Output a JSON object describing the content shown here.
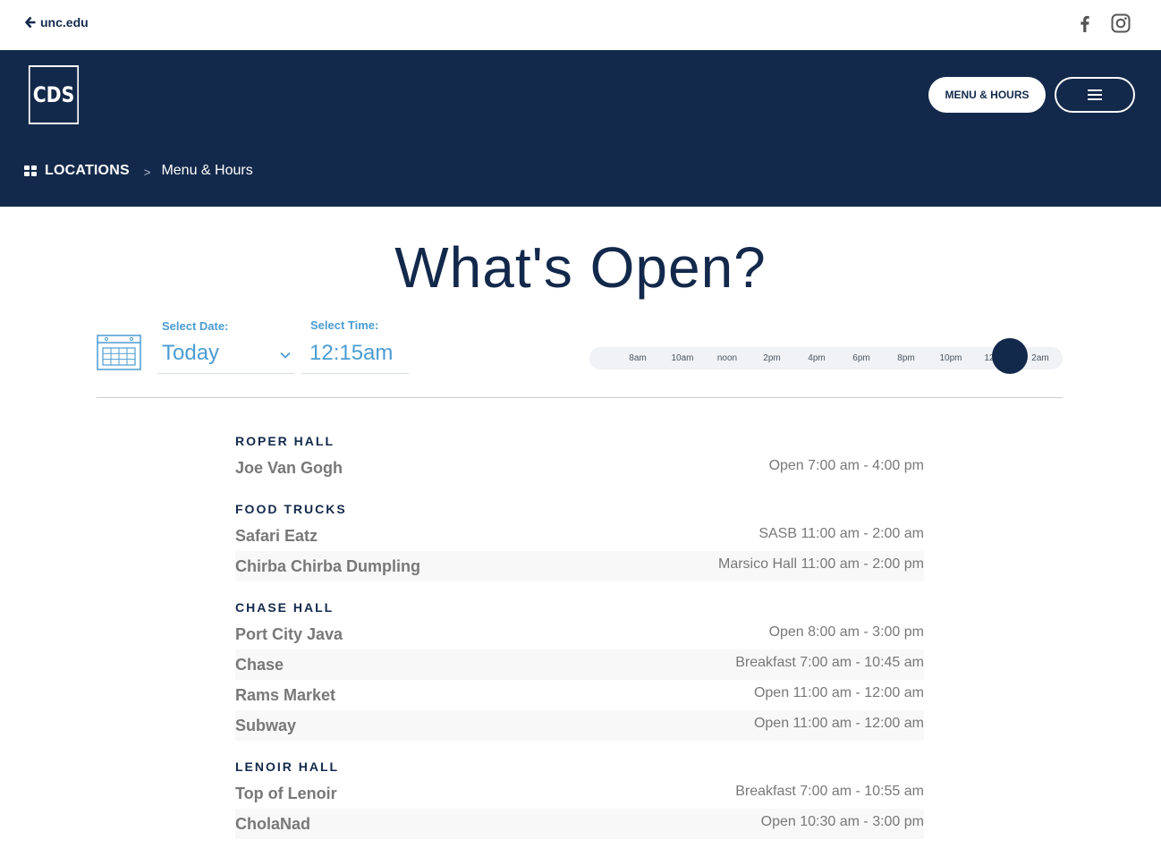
{
  "topbar": {
    "back_label": "unc.edu",
    "social": [
      {
        "icon": "facebook-icon"
      },
      {
        "icon": "instagram-icon"
      }
    ]
  },
  "header": {
    "logo_text": "CDS",
    "menu_hours_label": "MENU & HOURS",
    "breadcrumb": {
      "locations": "LOCATIONS",
      "separator": ">",
      "current": "Menu & Hours"
    }
  },
  "page": {
    "title": "What's Open?"
  },
  "controls": {
    "date_label": "Select Date:",
    "date_value": "Today",
    "time_label": "Select Time:",
    "time_value": "12:15am"
  },
  "slider": {
    "ticks": [
      "8am",
      "10am",
      "noon",
      "2pm",
      "4pm",
      "6pm",
      "8pm",
      "10pm",
      "12am",
      "2am"
    ],
    "current_value": "12:15am"
  },
  "sections": [
    {
      "title": "ROPER HALL",
      "rows": [
        {
          "name": "Joe Van Gogh",
          "hours": "Open 7:00 am - 4:00 pm"
        }
      ]
    },
    {
      "title": "FOOD TRUCKS",
      "rows": [
        {
          "name": "Safari Eatz",
          "hours": "SASB 11:00 am - 2:00 am"
        },
        {
          "name": "Chirba Chirba Dumpling",
          "hours": "Marsico Hall 11:00 am - 2:00 pm"
        }
      ]
    },
    {
      "title": "CHASE HALL",
      "rows": [
        {
          "name": "Port City Java",
          "hours": "Open 8:00 am - 3:00 pm"
        },
        {
          "name": "Chase",
          "hours": "Breakfast 7:00 am - 10:45 am"
        },
        {
          "name": "Rams Market",
          "hours": "Open 11:00 am - 12:00 am"
        },
        {
          "name": "Subway",
          "hours": "Open 11:00 am - 12:00 am"
        }
      ]
    },
    {
      "title": "LENOIR HALL",
      "rows": [
        {
          "name": "Top of Lenoir",
          "hours": "Breakfast 7:00 am - 10:55 am"
        },
        {
          "name": "CholaNad",
          "hours": "Open 10:30 am - 3:00 pm"
        }
      ]
    }
  ],
  "colors": {
    "navy": "#13294b",
    "carolina_blue": "#4b9cd3",
    "text_gray": "#787878"
  }
}
